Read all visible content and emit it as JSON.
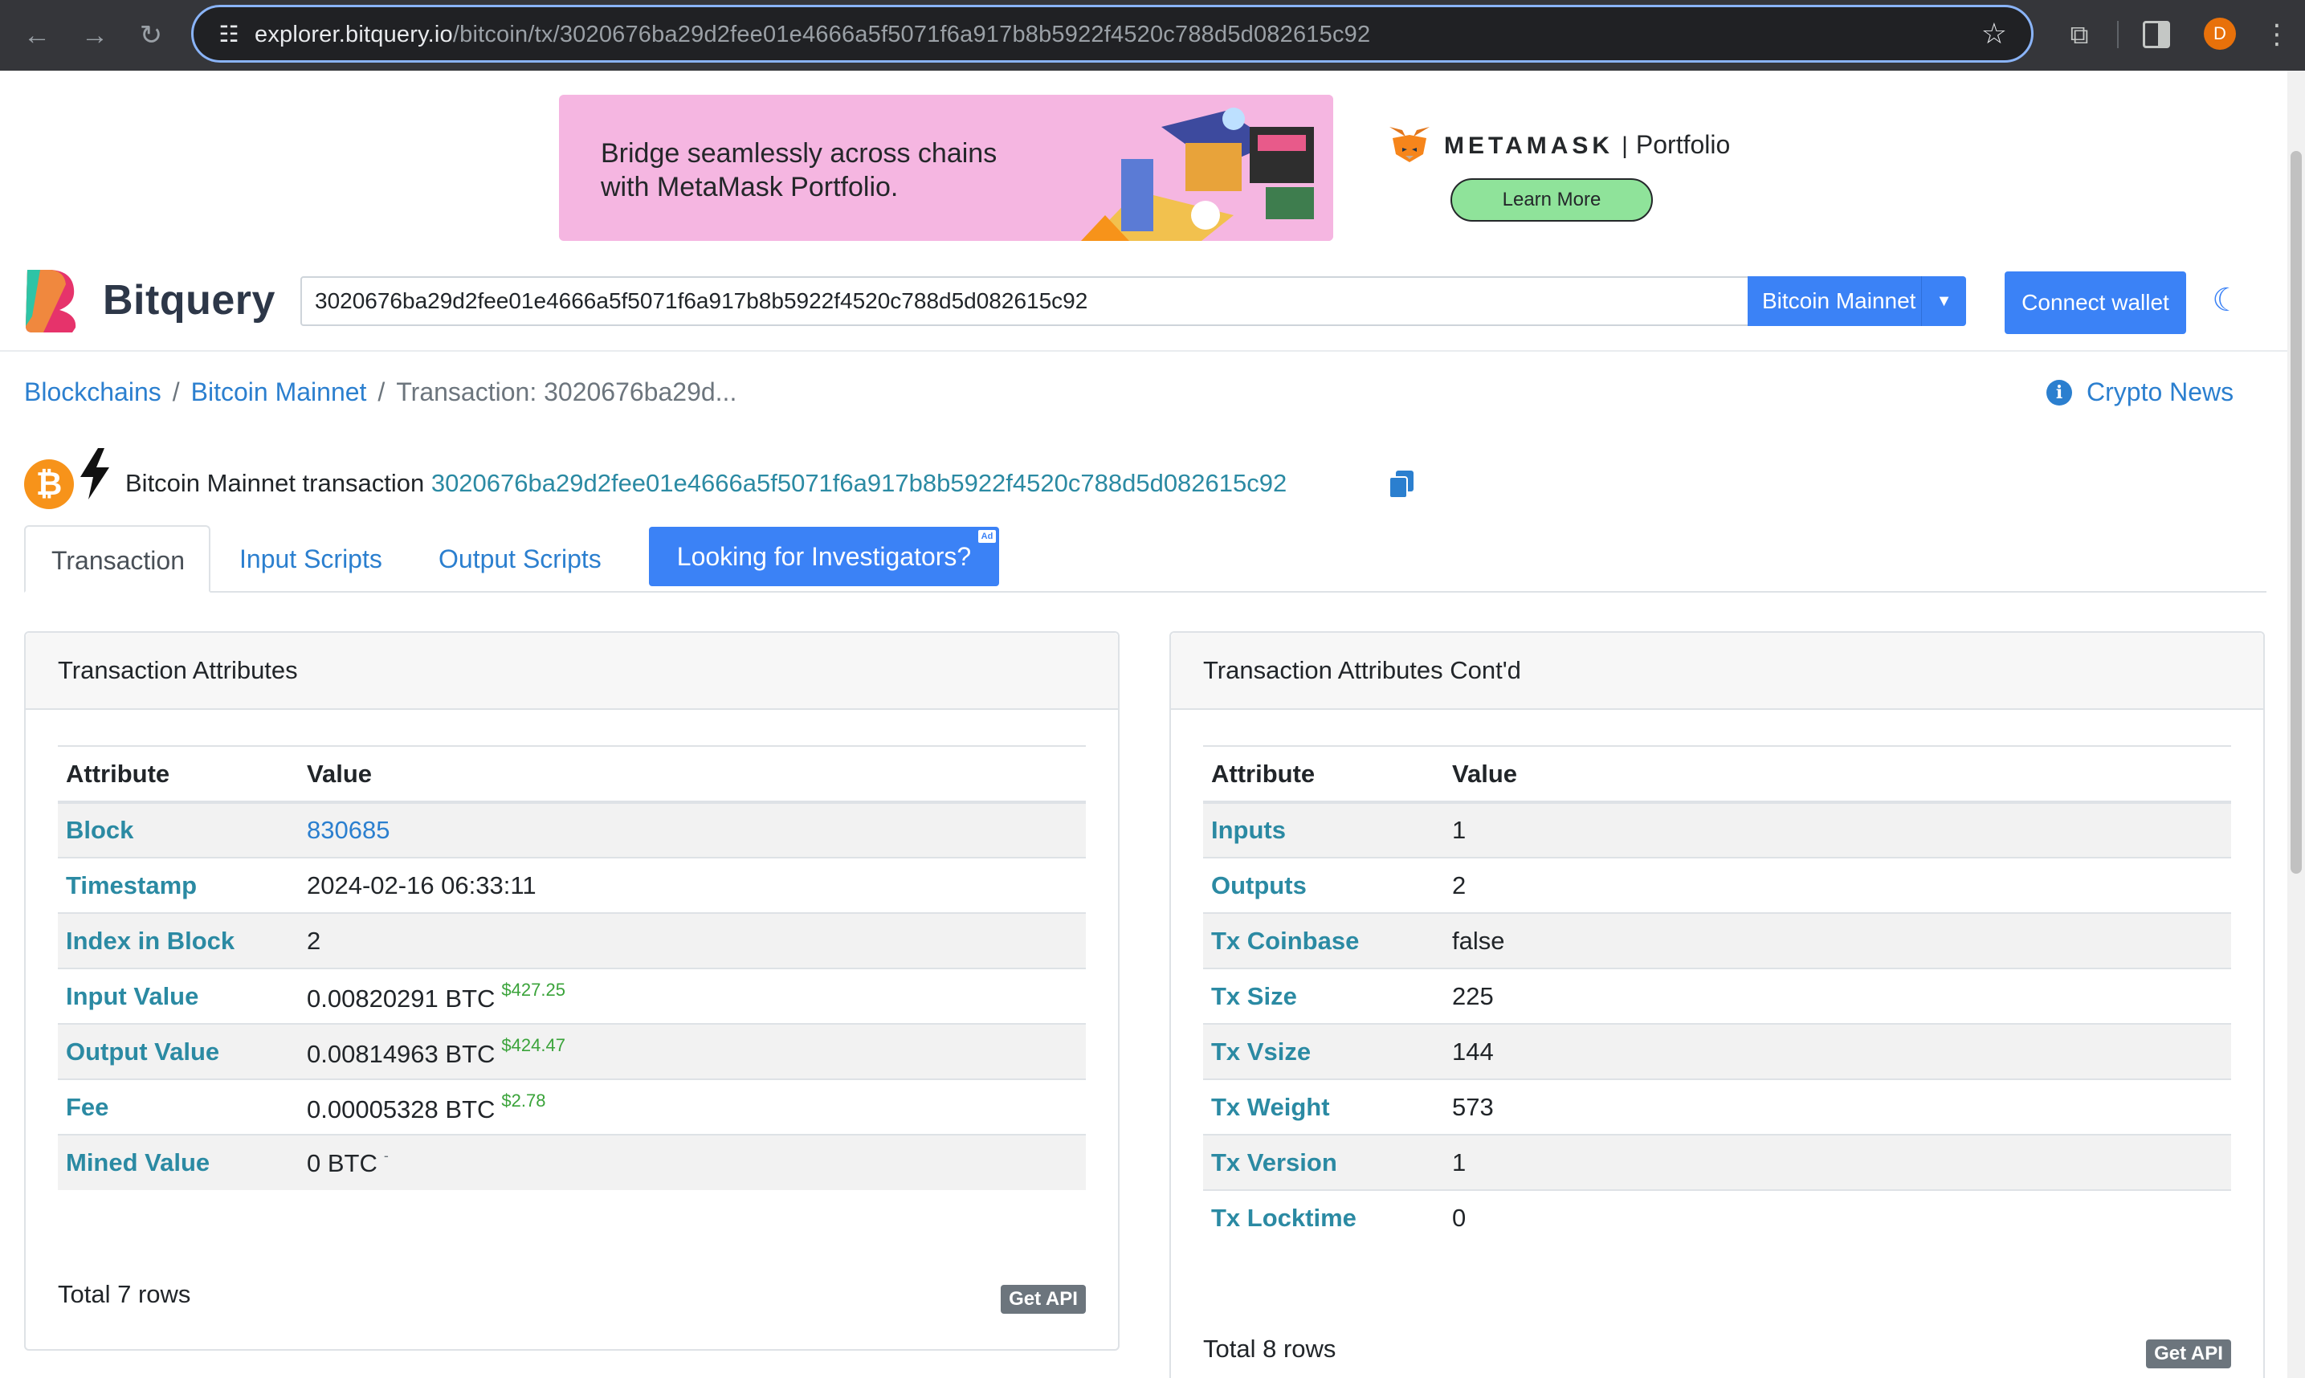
{
  "browser": {
    "url_host": "explorer.bitquery.io",
    "url_path": "/bitcoin/tx/3020676ba29d2fee01e4666a5f5071f6a917b8b5922f4520c788d5d082615c92",
    "profile_initial": "D"
  },
  "ad": {
    "line1": "Bridge seamlessly across chains",
    "line2": "with MetaMask Portfolio.",
    "brand": "METAMASK",
    "product": "Portfolio",
    "cta": "Learn More"
  },
  "header": {
    "logo_text": "Bitquery",
    "search_value": "3020676ba29d2fee01e4666a5f5071f6a917b8b5922f4520c788d5d082615c92",
    "network": "Bitcoin Mainnet",
    "connect_label": "Connect wallet"
  },
  "breadcrumb": {
    "item1": "Blockchains",
    "item2": "Bitcoin Mainnet",
    "current": "Transaction: 3020676ba29d..."
  },
  "news_link": "Crypto News",
  "tx": {
    "label": "Bitcoin Mainnet transaction",
    "hash": "3020676ba29d2fee01e4666a5f5071f6a917b8b5922f4520c788d5d082615c92"
  },
  "tabs": {
    "transaction": "Transaction",
    "input_scripts": "Input Scripts",
    "output_scripts": "Output Scripts",
    "investigators": "Looking for Investigators?",
    "ad_badge": "Ad"
  },
  "left_card": {
    "title": "Transaction Attributes",
    "col_attr": "Attribute",
    "col_value": "Value",
    "rows": [
      {
        "k": "Block",
        "v": "830685"
      },
      {
        "k": "Timestamp",
        "v": "2024-02-16 06:33:11"
      },
      {
        "k": "Index in Block",
        "v": "2"
      },
      {
        "k": "Input Value",
        "v": "0.00820291 BTC",
        "usd": "$427.25"
      },
      {
        "k": "Output Value",
        "v": "0.00814963 BTC",
        "usd": "$424.47"
      },
      {
        "k": "Fee",
        "v": "0.00005328 BTC",
        "usd": "$2.78"
      },
      {
        "k": "Mined Value",
        "v": "0 BTC",
        "usd": "-"
      }
    ],
    "total": "Total 7 rows",
    "api": "Get API"
  },
  "right_card": {
    "title": "Transaction Attributes Cont'd",
    "col_attr": "Attribute",
    "col_value": "Value",
    "rows": [
      {
        "k": "Inputs",
        "v": "1"
      },
      {
        "k": "Outputs",
        "v": "2"
      },
      {
        "k": "Tx Coinbase",
        "v": "false"
      },
      {
        "k": "Tx Size",
        "v": "225"
      },
      {
        "k": "Tx Vsize",
        "v": "144"
      },
      {
        "k": "Tx Weight",
        "v": "573"
      },
      {
        "k": "Tx Version",
        "v": "1"
      },
      {
        "k": "Tx Locktime",
        "v": "0"
      }
    ],
    "total": "Total 8 rows",
    "api": "Get API"
  },
  "colors": {
    "primary": "#3b82f6",
    "link": "#2b7fcf",
    "attr_key": "#2b8aa3",
    "usd": "#3aa33a",
    "bitcoin": "#f7931a",
    "ad_bg": "#f5b6e1"
  }
}
